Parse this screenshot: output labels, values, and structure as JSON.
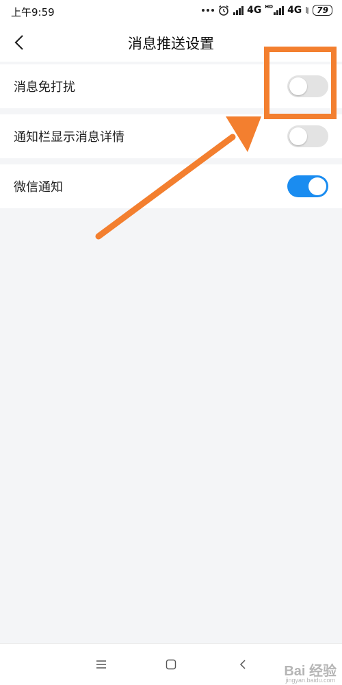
{
  "status_bar": {
    "time": "上午9:59",
    "network_1": "4G",
    "hd_label": "HD",
    "network_2": "4G",
    "battery": "79"
  },
  "header": {
    "title": "消息推送设置"
  },
  "settings": [
    {
      "label": "消息免打扰",
      "enabled": false
    },
    {
      "label": "通知栏显示消息详情",
      "enabled": false
    },
    {
      "label": "微信通知",
      "enabled": true
    }
  ],
  "colors": {
    "toggle_on": "#1a8cf0",
    "toggle_off": "#e3e3e3",
    "annotation": "#f37f2f"
  },
  "watermark": {
    "brand": "Bai 经验",
    "url": "jingyan.baidu.com"
  }
}
